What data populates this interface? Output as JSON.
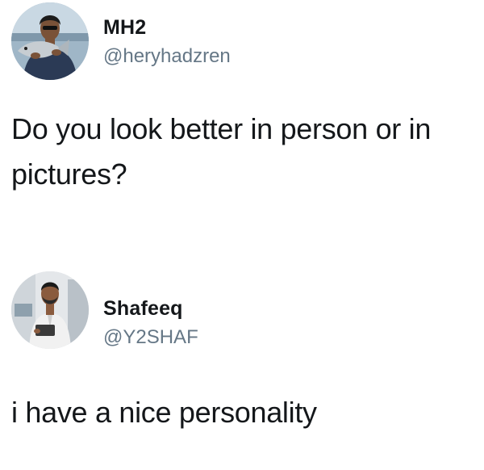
{
  "tweets": [
    {
      "author_name": "MH2",
      "author_handle": "@heryhadzren",
      "avatar_icon": "avatar-person-holding-fish-icon",
      "text": "Do you look better in person or in pictures?"
    },
    {
      "author_name": "Shafeeq",
      "author_handle": "@Y2SHAF",
      "avatar_icon": "avatar-person-in-office-icon",
      "text": "i have a nice personality"
    }
  ],
  "colors": {
    "background": "#ffffff",
    "primary_text": "#14171a",
    "secondary_text": "#657786"
  }
}
